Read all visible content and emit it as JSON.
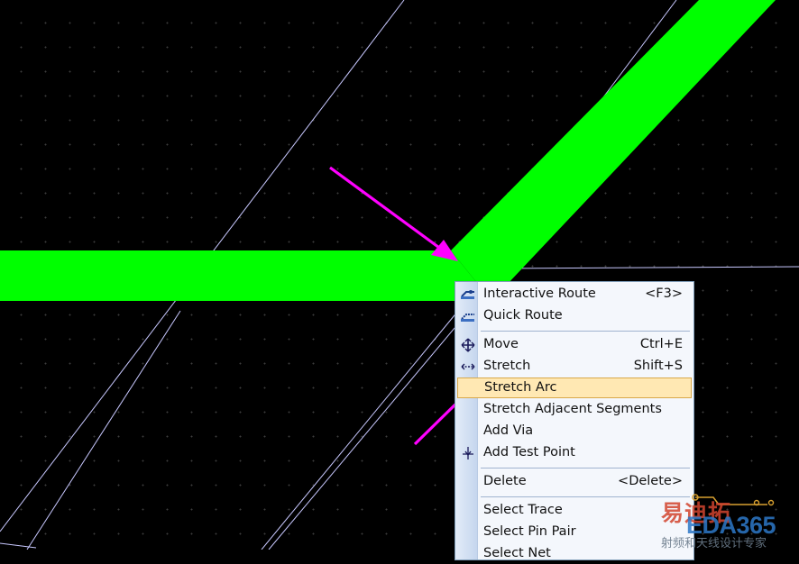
{
  "colors": {
    "trace": "#00ff00",
    "background": "#000000",
    "ratsnest": "#c8c8ff",
    "arrow": "#ff00ff",
    "menu_highlight": "#ffe8b3"
  },
  "context_menu": {
    "items": [
      {
        "label": "Interactive Route",
        "shortcut": "<F3>",
        "icon": "interactive-route-icon"
      },
      {
        "label": "Quick Route",
        "shortcut": "",
        "icon": "quick-route-icon"
      },
      {
        "label": "Move",
        "shortcut": "Ctrl+E",
        "icon": "move-icon"
      },
      {
        "label": "Stretch",
        "shortcut": "Shift+S",
        "icon": "stretch-icon"
      },
      {
        "label": "Stretch Arc",
        "shortcut": "",
        "icon": "",
        "highlighted": true
      },
      {
        "label": "Stretch Adjacent Segments",
        "shortcut": "",
        "icon": ""
      },
      {
        "label": "Add Via",
        "shortcut": "",
        "icon": ""
      },
      {
        "label": "Add Test Point",
        "shortcut": "",
        "icon": "test-point-icon"
      },
      {
        "label": "Delete",
        "shortcut": "<Delete>",
        "icon": ""
      },
      {
        "label": "Select Trace",
        "shortcut": "",
        "icon": ""
      },
      {
        "label": "Select Pin Pair",
        "shortcut": "",
        "icon": ""
      },
      {
        "label": "Select Net",
        "shortcut": "",
        "icon": ""
      }
    ]
  },
  "watermark": {
    "cn": "易迪拓",
    "en": "EDA365",
    "sub": "射频和天线设计专家"
  }
}
